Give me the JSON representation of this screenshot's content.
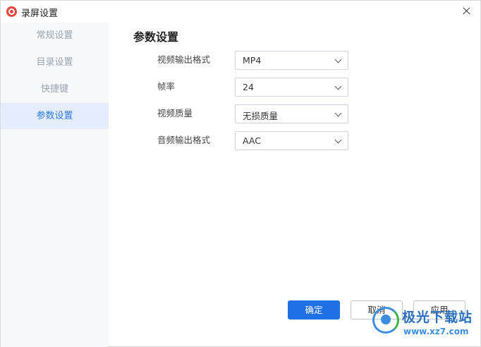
{
  "window": {
    "title": "录屏设置",
    "app_icon": "record-icon",
    "close_icon": "close-icon"
  },
  "sidebar": {
    "items": [
      {
        "label": "常规设置",
        "active": false
      },
      {
        "label": "目录设置",
        "active": false
      },
      {
        "label": "快捷键",
        "active": false
      },
      {
        "label": "参数设置",
        "active": true
      }
    ]
  },
  "main": {
    "title": "参数设置",
    "rows": [
      {
        "label": "视频输出格式",
        "value": "MP4"
      },
      {
        "label": "帧率",
        "value": "24"
      },
      {
        "label": "视频质量",
        "value": "无损质量"
      },
      {
        "label": "音频输出格式",
        "value": "AAC"
      }
    ]
  },
  "buttons": {
    "ok": "确定",
    "cancel": "取消",
    "apply": "应用"
  },
  "watermark": {
    "name": "极光下载站",
    "url": "www.xz7.com"
  },
  "colors": {
    "accent": "#1f6fe5",
    "sidebar_active_bg": "#e3edfb",
    "sidebar_active_text": "#2f7ae5"
  }
}
